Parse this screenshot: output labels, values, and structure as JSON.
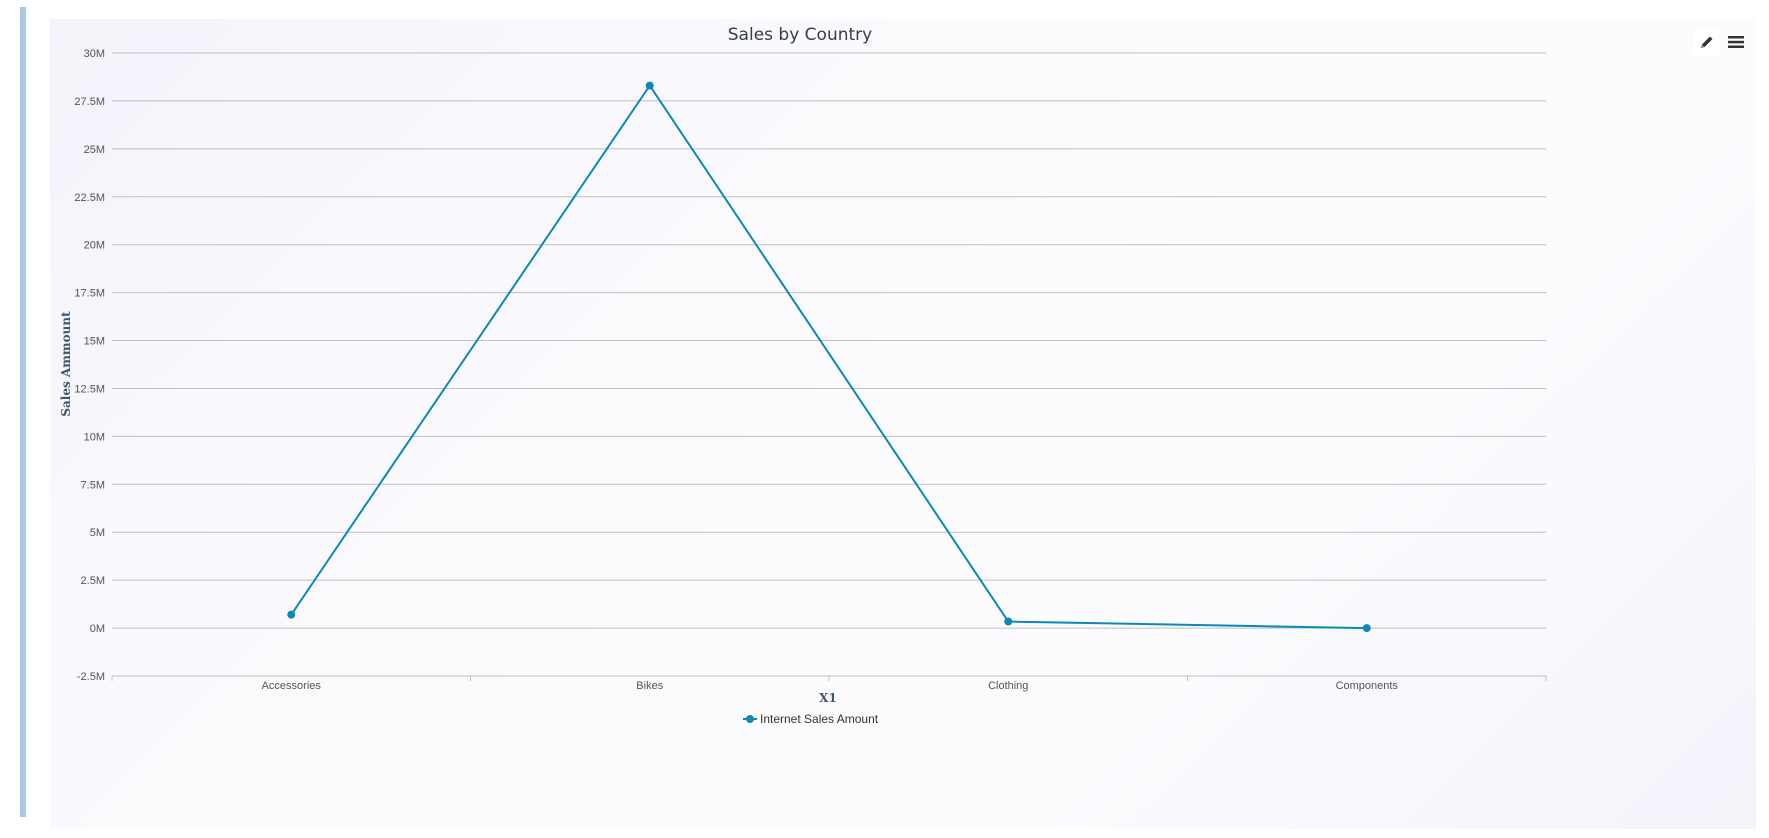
{
  "toolbar": {
    "edit_icon": "pencil-icon",
    "menu_icon": "hamburger-menu-icon"
  },
  "colors": {
    "series": "#0d89b7",
    "accent_bar": "#a9c8e6",
    "grid": "#c0c0c0"
  },
  "chart_data": {
    "type": "line",
    "title": "Sales by Country",
    "xlabel": "X1",
    "ylabel": "Sales Ammount",
    "categories": [
      "Accessories",
      "Bikes",
      "Clothing",
      "Components"
    ],
    "series": [
      {
        "name": "Internet Sales Amount",
        "values": [
          0.7,
          28.3,
          0.34,
          0.0
        ]
      }
    ],
    "ylim": [
      -2.5,
      30
    ],
    "yticks": [
      -2.5,
      0,
      2.5,
      5,
      7.5,
      10,
      12.5,
      15,
      17.5,
      20,
      22.5,
      25,
      27.5,
      30
    ],
    "ytick_labels": [
      "-2.5M",
      "0M",
      "2.5M",
      "5M",
      "7.5M",
      "10M",
      "12.5M",
      "15M",
      "17.5M",
      "20M",
      "22.5M",
      "25M",
      "27.5M",
      "30M"
    ],
    "grid": true,
    "legend_position": "bottom-center"
  }
}
